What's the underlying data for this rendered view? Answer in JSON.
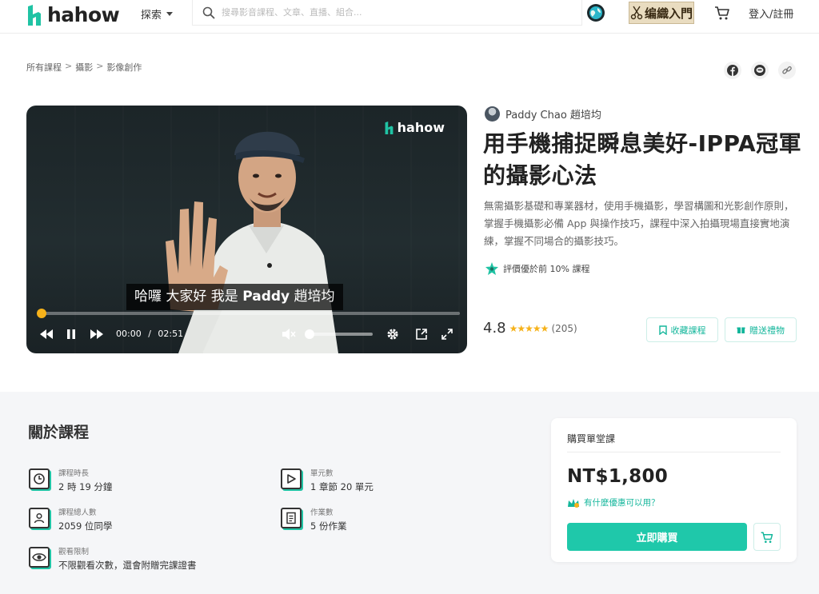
{
  "header": {
    "logo_text": "hahow",
    "explore_label": "探索",
    "search_placeholder": "搜尋影音課程、文章、直播、組合...",
    "promo_text": "编織入門",
    "login_label": "登入/註冊"
  },
  "breadcrumb": [
    "所有課程",
    "攝影",
    "影像創作"
  ],
  "breadcrumb_separator": ">",
  "share_icons": [
    "facebook-icon",
    "line-icon",
    "link-icon"
  ],
  "video": {
    "watermark": "hahow",
    "subtitle_prefix": "哈囉 大家好 我是 ",
    "subtitle_name": "Paddy",
    "subtitle_suffix": " 趙培均",
    "current_time": "00:00",
    "time_separator": "/",
    "duration": "02:51",
    "progress_fraction": 0.01,
    "volume_fraction": 0.0
  },
  "course": {
    "instructor": "Paddy Chao 趙培均",
    "title": "用手機捕捉瞬息美好-IPPA冠軍的攝影心法",
    "description": "無需攝影基礎和專業器材，使用手機攝影，學習構圖和光影創作原則，掌握手機攝影必備 App 與操作技巧，課程中深入拍攝現場直接實地演練，掌握不同場合的攝影技巧。",
    "badge": "評價優於前 10% 課程",
    "rating": "4.8",
    "stars": "★★★★★",
    "rating_count": "(205)",
    "favorite_label": "收藏課程",
    "gift_label": "贈送禮物"
  },
  "about": {
    "title": "關於課程",
    "stats": [
      {
        "label": "課程時長",
        "value": "2 時 19 分鐘",
        "icon": "clock-icon"
      },
      {
        "label": "單元數",
        "value": "1 章節 20 單元",
        "icon": "play-icon"
      },
      {
        "label": "課程總人數",
        "value": "2059 位同學",
        "icon": "students-icon"
      },
      {
        "label": "作業數",
        "value": "5 份作業",
        "icon": "assignment-icon"
      },
      {
        "label": "觀看限制",
        "value": "不限觀看次數，還會附贈完課證書",
        "icon": "eye-icon"
      }
    ]
  },
  "purchase": {
    "heading": "購買單堂課",
    "price": "NT$1,800",
    "discount_text": "有什麼優惠可以用？",
    "buy_label": "立即購買"
  },
  "colors": {
    "accent": "#1fc8aa",
    "accent_text": "#13b69b",
    "progress": "#f6b21a",
    "star": "#f6b21a"
  }
}
